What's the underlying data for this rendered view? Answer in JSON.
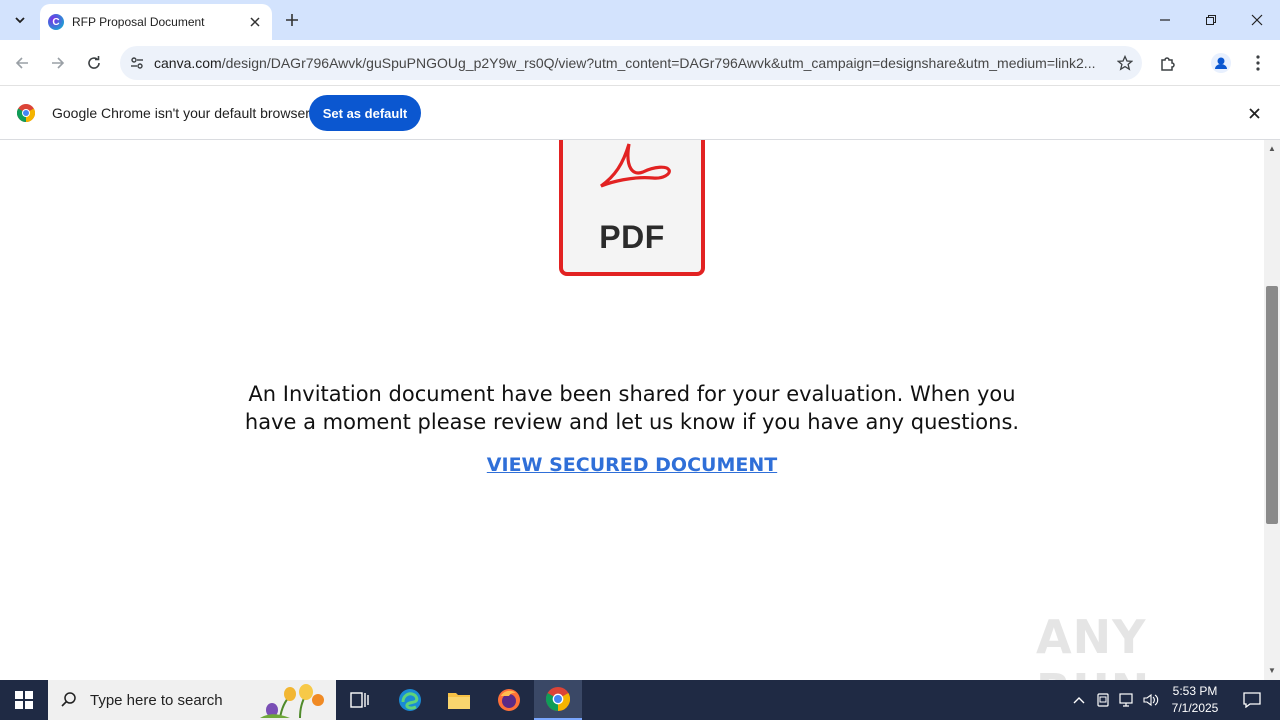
{
  "browser": {
    "tab": {
      "title": "RFP Proposal Document",
      "favicon": "canva-favicon-icon"
    },
    "new_tab_label": "+",
    "url": {
      "domain": "canva.com",
      "path": "/design/DAGr796Awvk/guSpuPNGOUg_p2Y9w_rs0Q/view?utm_content=DAGr796Awvk&utm_campaign=designshare&utm_medium=link2..."
    }
  },
  "infobar": {
    "message": "Google Chrome isn't your default browser",
    "button_label": "Set as default"
  },
  "content": {
    "pdf_label": "PDF",
    "message": "An Invitation document have been shared for your evaluation. When you have a moment please review and let us know if you have any questions.",
    "link_text": "VIEW SECURED DOCUMENT",
    "watermark": "ANY RUN"
  },
  "taskbar": {
    "search_placeholder": "Type here to search",
    "time": "5:53 PM",
    "date": "7/1/2025"
  },
  "colors": {
    "tabstrip": "#d3e3fd",
    "accent_button": "#0b57d0",
    "pdf_red": "#e22222",
    "link_blue": "#2f6fd8",
    "taskbar": "#1f2a44"
  }
}
